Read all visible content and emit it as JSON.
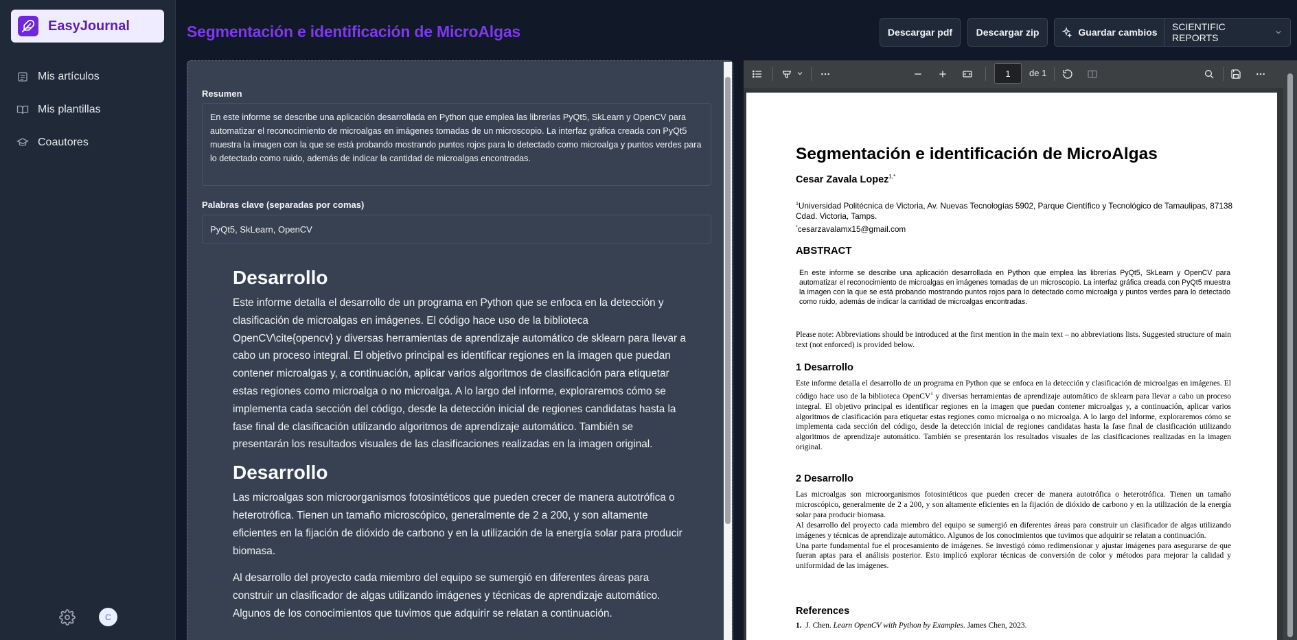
{
  "app": {
    "name": "EasyJournal",
    "accent": "#7c3aed"
  },
  "sidebar": {
    "items": [
      {
        "label": "Mis artículos",
        "icon": "newspaper-icon"
      },
      {
        "label": "Mis plantillas",
        "icon": "book-icon"
      },
      {
        "label": "Coautores",
        "icon": "graduation-cap-icon"
      }
    ],
    "avatar_initial": "C"
  },
  "header": {
    "title": "Segmentación e identificación de MicroAlgas",
    "download_pdf": "Descargar pdf",
    "download_zip": "Descargar zip",
    "save_changes": "Guardar cambios",
    "journal": "SCIENTIFIC REPORTS"
  },
  "editor": {
    "summary_label": "Resumen",
    "summary_value": "En este informe se describe una aplicación desarrollada en Python que emplea las librerías PyQt5, SkLearn y OpenCV para automatizar el reconocimiento de microalgas en imágenes tomadas de un microscopio. La interfaz gráfica creada con PyQt5 muestra la imagen con la que se está probando mostrando puntos rojos para lo detectado como microalga y puntos verdes para lo detectado como ruido, además de indicar la cantidad de microalgas encontradas.",
    "keywords_label": "Palabras clave (separadas por comas)",
    "keywords_value": "PyQt5, SkLearn, OpenCV",
    "section1_heading": "Desarrollo",
    "section1_p1": "Este informe detalla el desarrollo de un programa en Python que se enfoca en la detección y clasificación de microalgas en imágenes. El código hace uso de la biblioteca OpenCV\\cite{opencv} y diversas herramientas de aprendizaje automático de sklearn para llevar a cabo un proceso integral. El objetivo principal es identificar regiones en la imagen que puedan contener microalgas y, a continuación, aplicar varios algoritmos de clasificación para etiquetar estas regiones como microalga o no microalga. A lo largo del informe, exploraremos cómo se implementa cada sección del código, desde la detección inicial de regiones candidatas hasta la fase final de clasificación utilizando algoritmos de aprendizaje automático. También se presentarán los resultados visuales de las clasificaciones realizadas en la imagen original.",
    "section2_heading": "Desarrollo",
    "section2_p1": "Las microalgas son microorganismos fotosintéticos que pueden crecer de manera autotrófica o heterotrófica. Tienen un tamaño microscópico, generalmente de 2 a 200, y son altamente eficientes en la fijación de dióxido de carbono y en la utilización de la energía solar para producir biomasa.",
    "section2_p2": "Al desarrollo del proyecto cada miembro del equipo se sumergió en diferentes áreas para construir un clasificador de algas utilizando imágenes y técnicas de aprendizaje automático. Algunos de los conocimientos que tuvimos que adquirir se relatan a continuación."
  },
  "pdf_viewer": {
    "page_number": "1",
    "page_of": "de 1",
    "doc": {
      "title": "Segmentación e identificación de MicroAlgas",
      "author": "Cesar Zavala Lopez",
      "author_sup": "1,*",
      "affiliation": "Universidad Politécnica de Victoria, Av. Nuevas Tecnologías 5902, Parque Científico y Tecnológico de Tamaulipas, 87138 Cdad. Victoria, Tamps.",
      "affiliation_sup": "1",
      "email_sup": "*",
      "email": "cesarzavalamx15@gmail.com",
      "abstract_heading": "ABSTRACT",
      "abstract": "En este informe se describe una aplicación desarrollada en Python que emplea las librerías PyQt5, SkLearn y OpenCV para automatizar el reconocimiento de microalgas en imágenes tomadas de un microscopio. La interfaz gráfica creada con PyQt5 muestra la imagen con la que se está probando mostrando puntos rojos para lo detectado como microalga y puntos verdes para lo detectado como ruido, además de indicar la cantidad de microalgas encontradas.",
      "note": "Please note: Abbreviations should be introduced at the first mention in the main text – no abbreviations lists. Suggested structure of main text (not enforced) is provided below.",
      "s1_heading": "1  Desarrollo",
      "s1_a": "Este informe detalla el desarrollo de un programa en Python que se enfoca en la detección y clasificación de microalgas en imágenes. El código hace uso de la biblioteca OpenCV",
      "s1_sup": "1",
      "s1_b": " y diversas herramientas de aprendizaje automático de sklearn para llevar a cabo un proceso integral. El objetivo principal es identificar regiones en la imagen que puedan contener microalgas y, a continuación, aplicar varios algoritmos de clasificación para etiquetar estas regiones como microalga o no microalga. A lo largo del informe, exploraremos cómo se implementa cada sección del código, desde la detección inicial de regiones candidatas hasta la fase final de clasificación utilizando algoritmos de aprendizaje automático. También se presentarán los resultados visuales de las clasificaciones realizadas en la imagen original.",
      "s2_heading": "2  Desarrollo",
      "s2_p1": "Las microalgas son microorganismos fotosintéticos que pueden crecer de manera autotrófica o heterotrófica. Tienen un tamaño microscópico, generalmente de 2 a 200, y son altamente eficientes en la fijación de dióxido de carbono y en la utilización de la energía solar para producir biomasa.",
      "s2_p2": "Al desarrollo del proyecto cada miembro del equipo se sumergió en diferentes áreas para construir un clasificador de algas utilizando imágenes y técnicas de aprendizaje automático. Algunos de los conocimientos que tuvimos que adquirir se relatan a continuación.",
      "s2_p3": "Una parte fundamental fue el procesamiento de imágenes. Se investigó cómo redimensionar y ajustar imágenes para asegurarse de que fueran aptas para el análisis posterior. Esto implicó explorar técnicas de conversión de color y métodos para mejorar la calidad y uniformidad de las imágenes.",
      "refs_heading": "References",
      "ref1_num": "1.",
      "ref1_authors": "J. Chen.",
      "ref1_title": "Learn OpenCV with Python by Examples",
      "ref1_rest": ". James Chen, 2023."
    }
  }
}
